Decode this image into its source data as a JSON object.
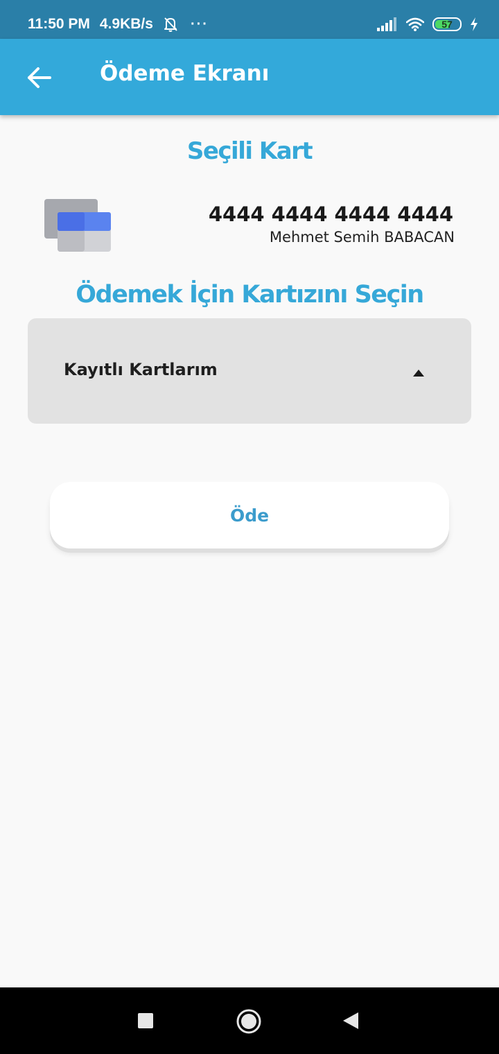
{
  "status_bar": {
    "time": "11:50 PM",
    "speed": "4.9KB/s",
    "more": "···",
    "battery": "57",
    "colors": {
      "background": "#2a7fa8",
      "battery_fill": "#4cd964"
    }
  },
  "app_bar": {
    "title": "Ödeme Ekranı",
    "back_icon": "arrow-left-icon",
    "color": "#33a9da"
  },
  "selected_card": {
    "heading": "Seçili Kart",
    "number": "4444 4444 4444 4444",
    "holder": "Mehmet Semih BABACAN",
    "icon": "credit-cards-icon"
  },
  "select_section": {
    "heading": "Ödemek İçin Kartızını Seçin",
    "dropdown_value": "Kayıtlı Kartlarım",
    "dropdown_icon": "caret-up-icon"
  },
  "pay_button": {
    "label": "Öde"
  },
  "nav": {
    "recents_icon": "square-icon",
    "home_icon": "circle-icon",
    "back_icon": "triangle-back-icon"
  },
  "accent_color": "#36a8d8"
}
